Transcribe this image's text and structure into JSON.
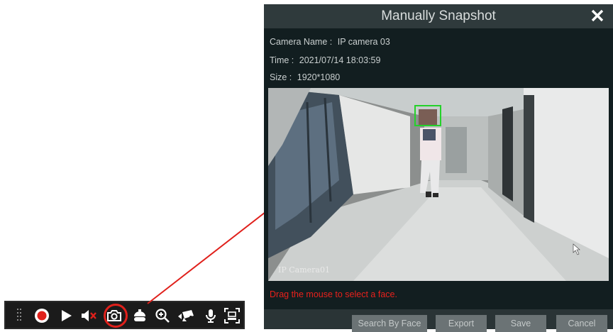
{
  "dialog": {
    "title": "Manually Snapshot",
    "camera_name_label": "Camera Name :",
    "camera_name_value": "IP camera 03",
    "time_label": "Time :",
    "time_value": "2021/07/14 18:03:59",
    "size_label": "Size :",
    "size_value": "1920*1080",
    "snapshot_overlay": "IP Camera01",
    "hint": "Drag the mouse to select a face.",
    "buttons": {
      "search_by_face": "Search By Face",
      "export": "Export",
      "save": "Save",
      "cancel": "Cancel"
    }
  },
  "toolbar": {
    "icons": [
      "grip-icon",
      "record-icon",
      "play-icon",
      "mute-icon",
      "snapshot-icon",
      "ptz-icon",
      "zoom-in-icon",
      "camera-switch-icon",
      "microphone-icon",
      "face-capture-icon"
    ],
    "highlight_color": "#e0201b"
  },
  "colors": {
    "dialog_bg": "#121e20",
    "titlebar_bg": "#2f3a3c",
    "hint_red": "#e8211c",
    "face_box_green": "#25d12a"
  }
}
